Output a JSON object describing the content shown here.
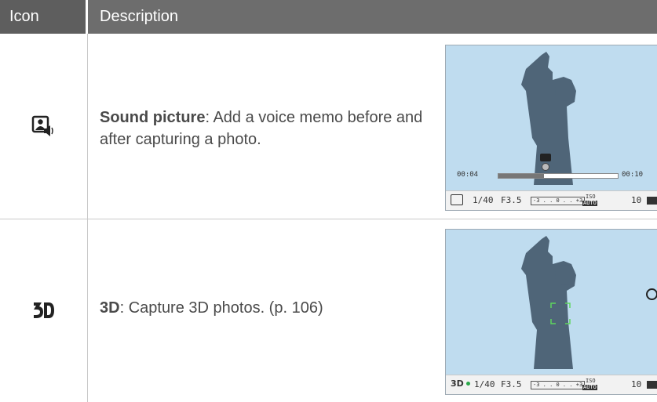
{
  "header": {
    "icon_col": "Icon",
    "desc_col": "Description"
  },
  "rows": [
    {
      "icon": "sound-picture-icon",
      "title": "Sound picture",
      "text": ": Add a voice memo before and after capturing a photo.",
      "screen": {
        "time_start": "00:04",
        "time_end": "00:10",
        "shutter": "1/40",
        "aperture": "F3.5",
        "ev_scale": "-3 . . 0 . . +3",
        "iso_top": "ISO",
        "iso_bottom": "AUTO",
        "shots": "10"
      }
    },
    {
      "icon": "3d-icon",
      "title": "3D",
      "text": ": Capture 3D photos. (p. 106)",
      "screen": {
        "shutter": "1/40",
        "aperture": "F3.5",
        "ev_scale": "-3 . . 0 . . +3",
        "iso_top": "ISO",
        "iso_bottom": "AUTO",
        "shots": "10",
        "flash": "flash-off-icon"
      }
    }
  ]
}
